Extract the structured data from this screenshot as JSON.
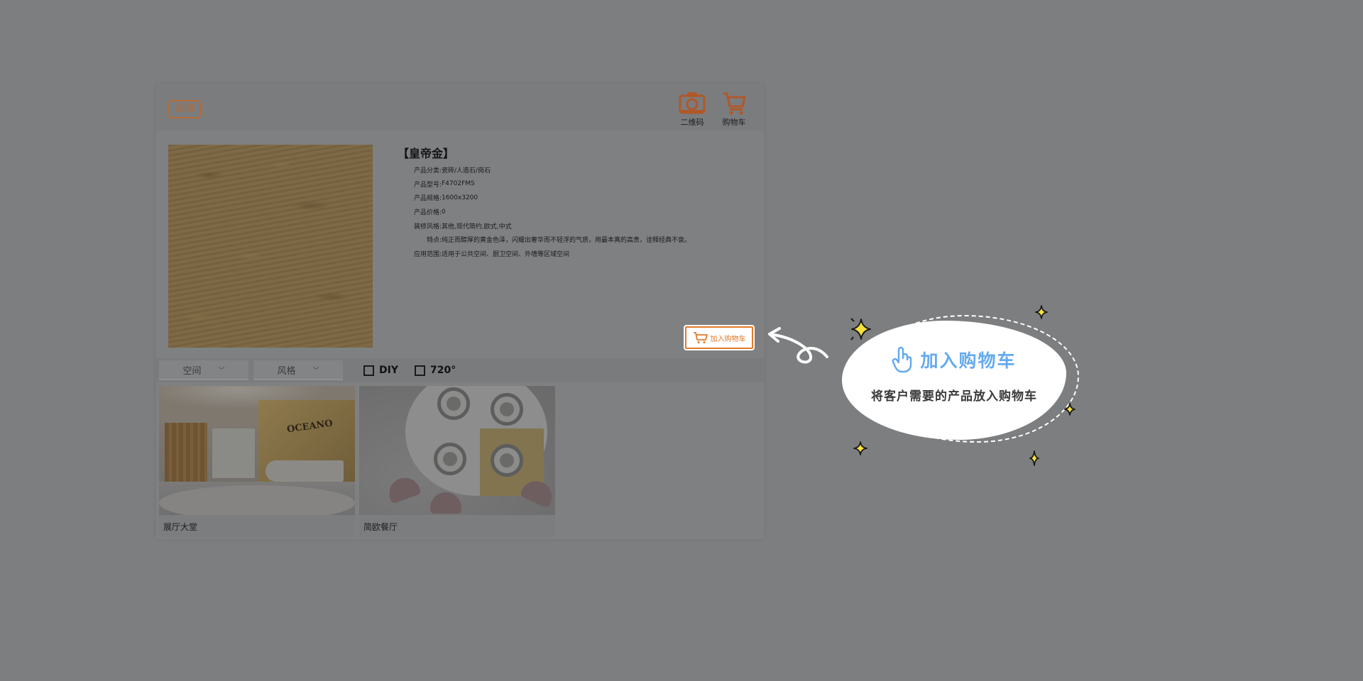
{
  "header": {
    "back_label": "返回",
    "qr_label": "二维码",
    "cart_label": "购物车"
  },
  "product": {
    "title": "【皇帝金】",
    "specs": [
      {
        "label": "产品分类:",
        "value": "瓷砖/人造石/岗石"
      },
      {
        "label": "产品型号:",
        "value": "F4702FMS"
      },
      {
        "label": "产品规格:",
        "value": "1600x3200"
      },
      {
        "label": "产品价格:",
        "value": "0"
      },
      {
        "label": "装修风格:",
        "value": "其他,现代简约,欧式,中式"
      },
      {
        "label": "特点:",
        "value": "纯正而醇厚的黄金色泽，闪耀出奢华而不轻浮的气质，用最本真的高贵，诠释经典不衰。"
      },
      {
        "label": "应用范围:",
        "value": "适用于公共空间、厨卫空间、外墙等区域空间"
      }
    ],
    "add_to_cart_label": "加入购物车"
  },
  "filters": {
    "space_label": "空间",
    "style_label": "风格",
    "diy_label": "DIY",
    "pano_label": "720°"
  },
  "scenes": [
    {
      "label": "展厅大堂",
      "brand": "OCEANO"
    },
    {
      "label": "简欧餐厅"
    }
  ],
  "tutorial": {
    "title": "加入购物车",
    "subtitle": "将客户需要的产品放入购物车"
  },
  "colors": {
    "accent": "#e07a2a",
    "tutorial_title": "#64aaf0",
    "overlay_bg": "#7d7e80"
  },
  "icons": {
    "qr": "camera-icon",
    "cart": "shopping-cart-icon",
    "hand": "pointer-hand-icon"
  }
}
